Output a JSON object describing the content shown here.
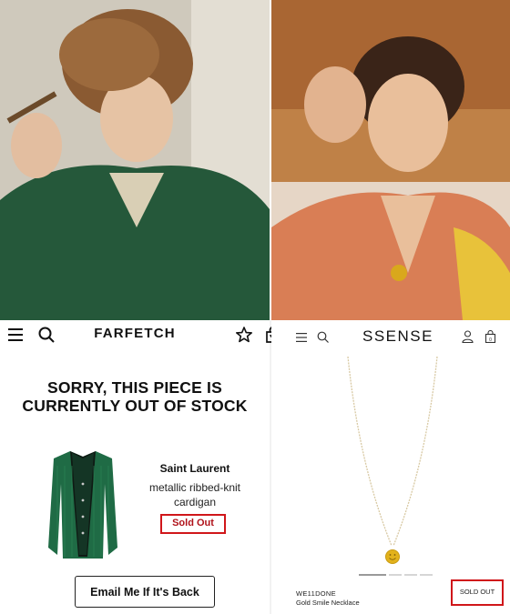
{
  "farfetch": {
    "logo": "FARFETCH",
    "icons": [
      "menu-icon",
      "search-icon",
      "star-icon",
      "shopping-bag-icon"
    ],
    "heading": "SORRY, THIS PIECE IS CURRENTLY OUT OF STOCK",
    "product": {
      "brand": "Saint Laurent",
      "name": "metallic ribbed-knit cardigan",
      "status": "Sold Out"
    },
    "email_button": "Email Me If It's Back"
  },
  "ssense": {
    "logo": "SSENSE",
    "icons": [
      "menu-icon",
      "search-icon",
      "user-icon",
      "shopping-bag-icon"
    ],
    "product": {
      "brand": "WE11DONE",
      "name": "Gold Smile Necklace",
      "status": "SOLD OUT"
    },
    "carousel": {
      "slides": 4,
      "active_index": 0
    }
  },
  "colors": {
    "highlight_border": "#d0161a",
    "sold_out_text": "#b0121a",
    "cardigan_green": "#1f6b45"
  }
}
